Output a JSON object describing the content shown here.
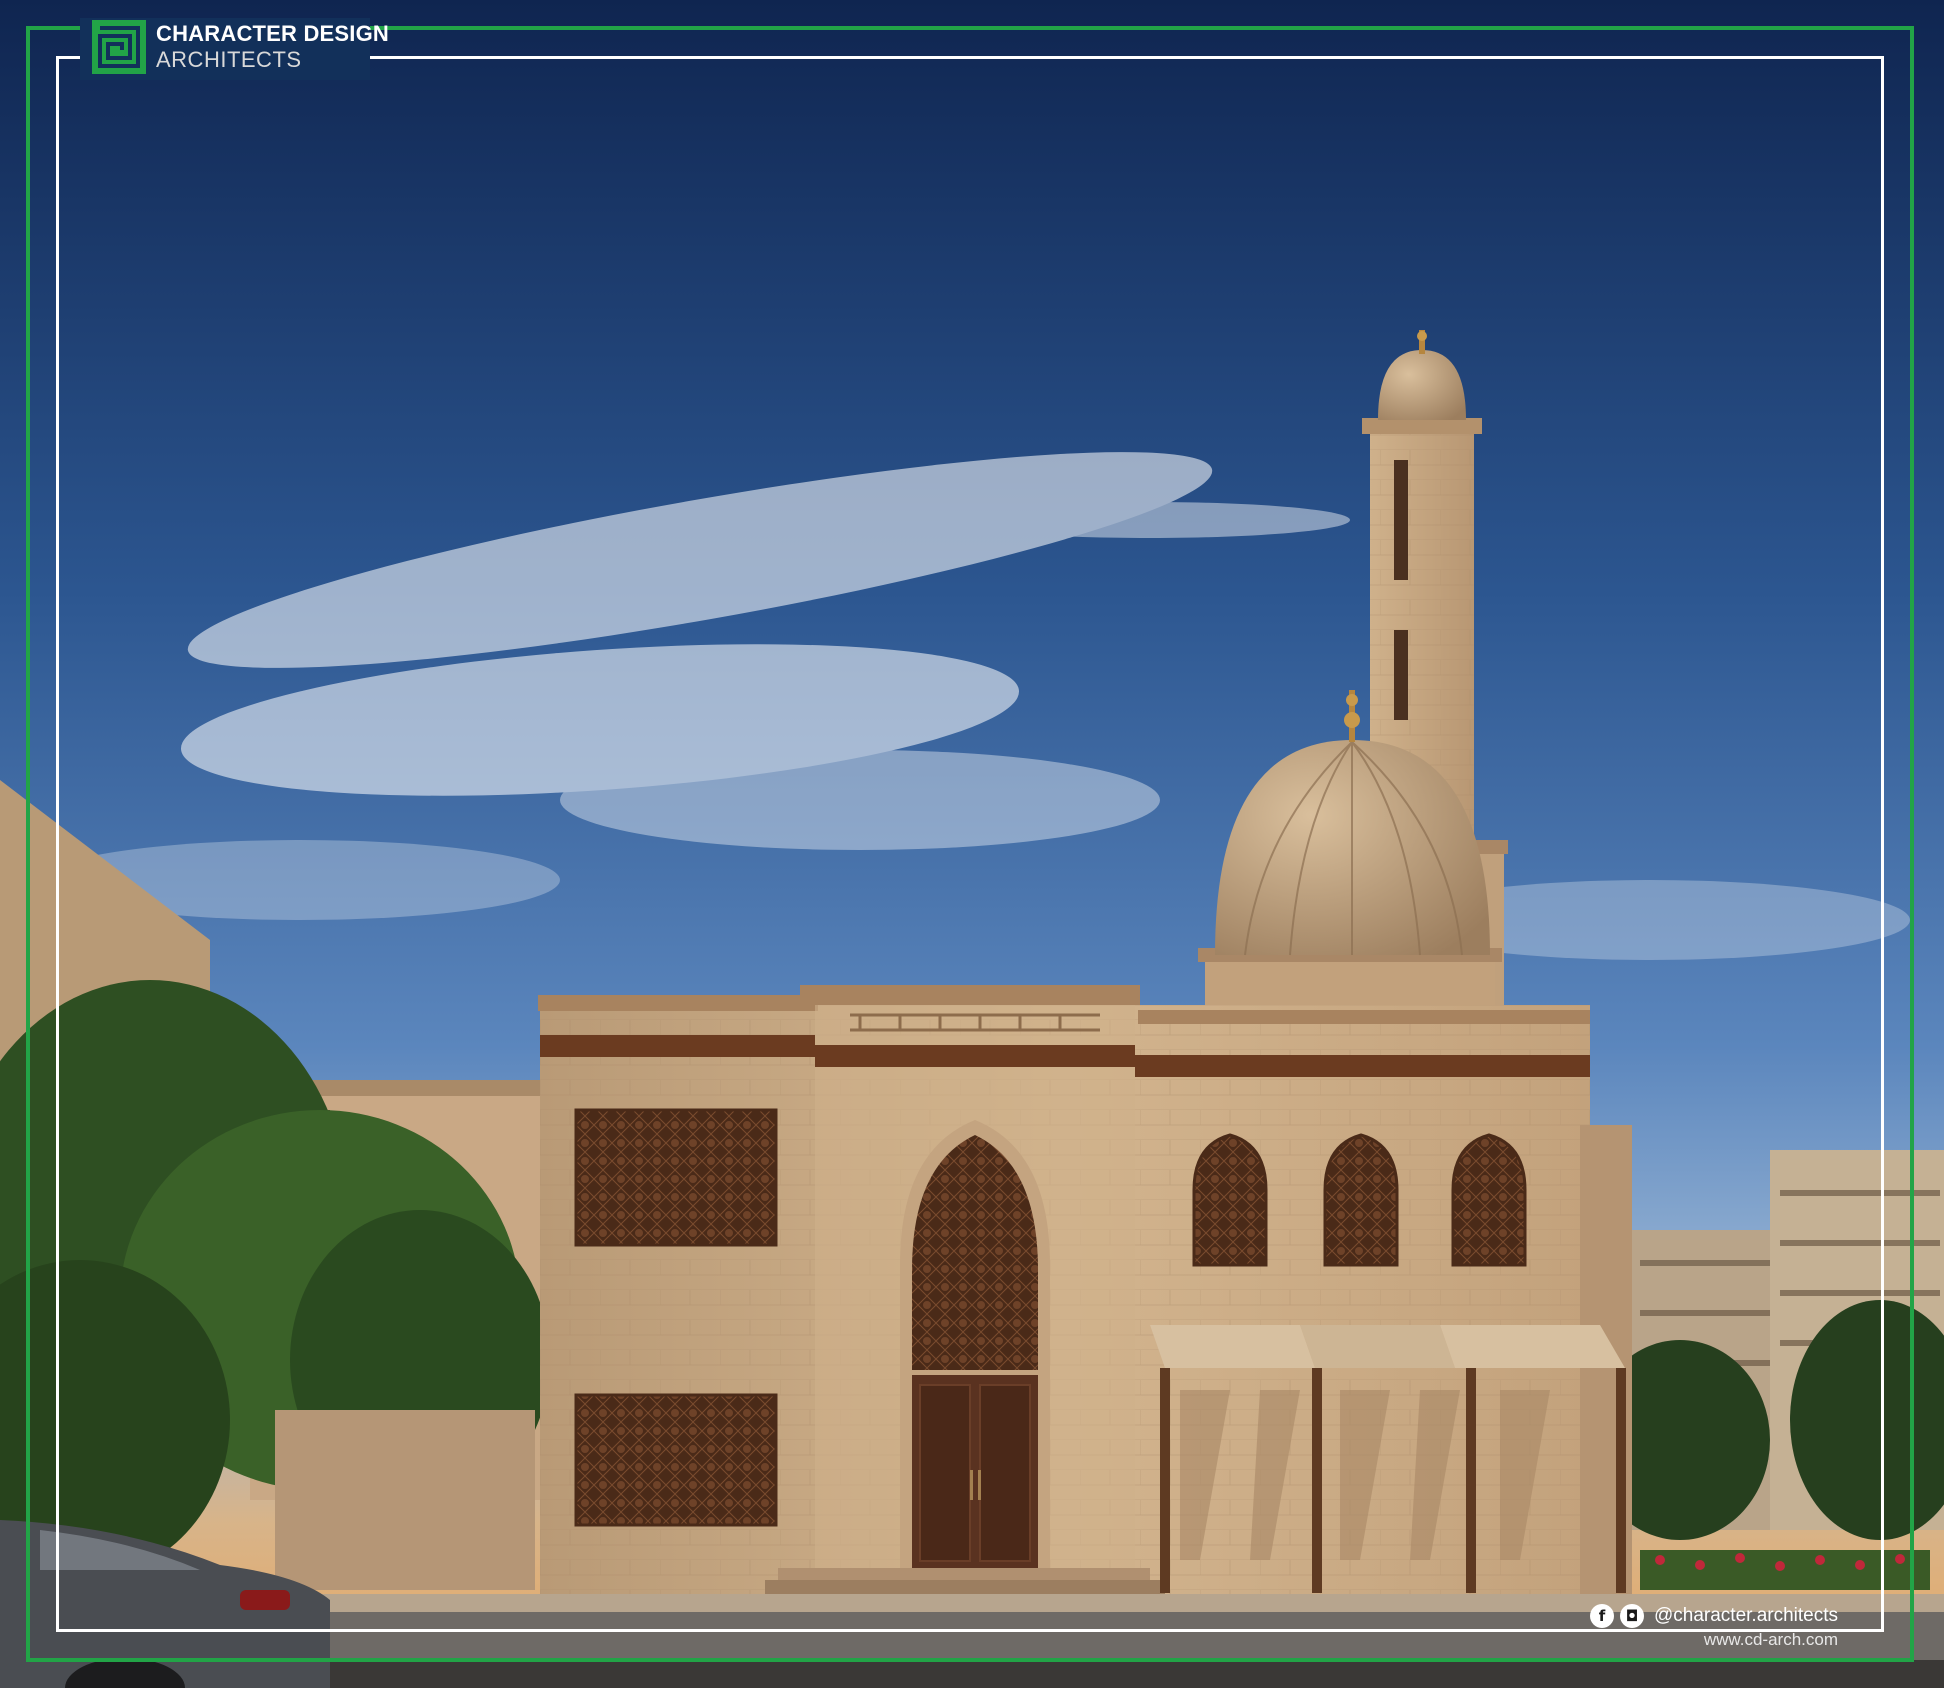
{
  "brand": {
    "line1": "CHARACTER DESIGN",
    "line2": "ARCHITECTS",
    "accent": "#22a447"
  },
  "footer": {
    "social_icons": [
      "facebook-icon",
      "instagram-icon"
    ],
    "facebook_glyph": "f",
    "instagram_glyph": "◘",
    "handle": "@character.architects",
    "website": "www.cd-arch.com"
  },
  "palette": {
    "sky_top": "#16325f",
    "sky_mid": "#3d6ca6",
    "sky_horizon": "#e8a866",
    "stone": "#c9a982",
    "wood": "#5b3320",
    "frame_white": "#ffffff"
  }
}
